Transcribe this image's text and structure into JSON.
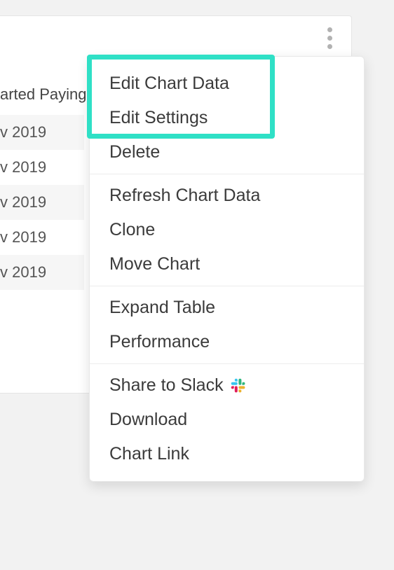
{
  "table": {
    "column_header": "arted Paying",
    "rows": [
      "v 2019",
      "v 2019",
      "v 2019",
      "v 2019",
      "v 2019"
    ]
  },
  "menu": {
    "groups": [
      {
        "items": [
          {
            "name": "edit-chart-data",
            "label": "Edit Chart Data"
          },
          {
            "name": "edit-settings",
            "label": "Edit Settings"
          },
          {
            "name": "delete",
            "label": "Delete"
          }
        ]
      },
      {
        "items": [
          {
            "name": "refresh-chart-data",
            "label": "Refresh Chart Data"
          },
          {
            "name": "clone",
            "label": "Clone"
          },
          {
            "name": "move-chart",
            "label": "Move Chart"
          }
        ]
      },
      {
        "items": [
          {
            "name": "expand-table",
            "label": "Expand Table"
          },
          {
            "name": "performance",
            "label": "Performance"
          }
        ]
      },
      {
        "items": [
          {
            "name": "share-to-slack",
            "label": "Share to Slack",
            "icon": "slack-icon"
          },
          {
            "name": "download",
            "label": "Download"
          },
          {
            "name": "chart-link",
            "label": "Chart Link"
          }
        ]
      }
    ]
  },
  "highlight_color": "#2fe0c6"
}
